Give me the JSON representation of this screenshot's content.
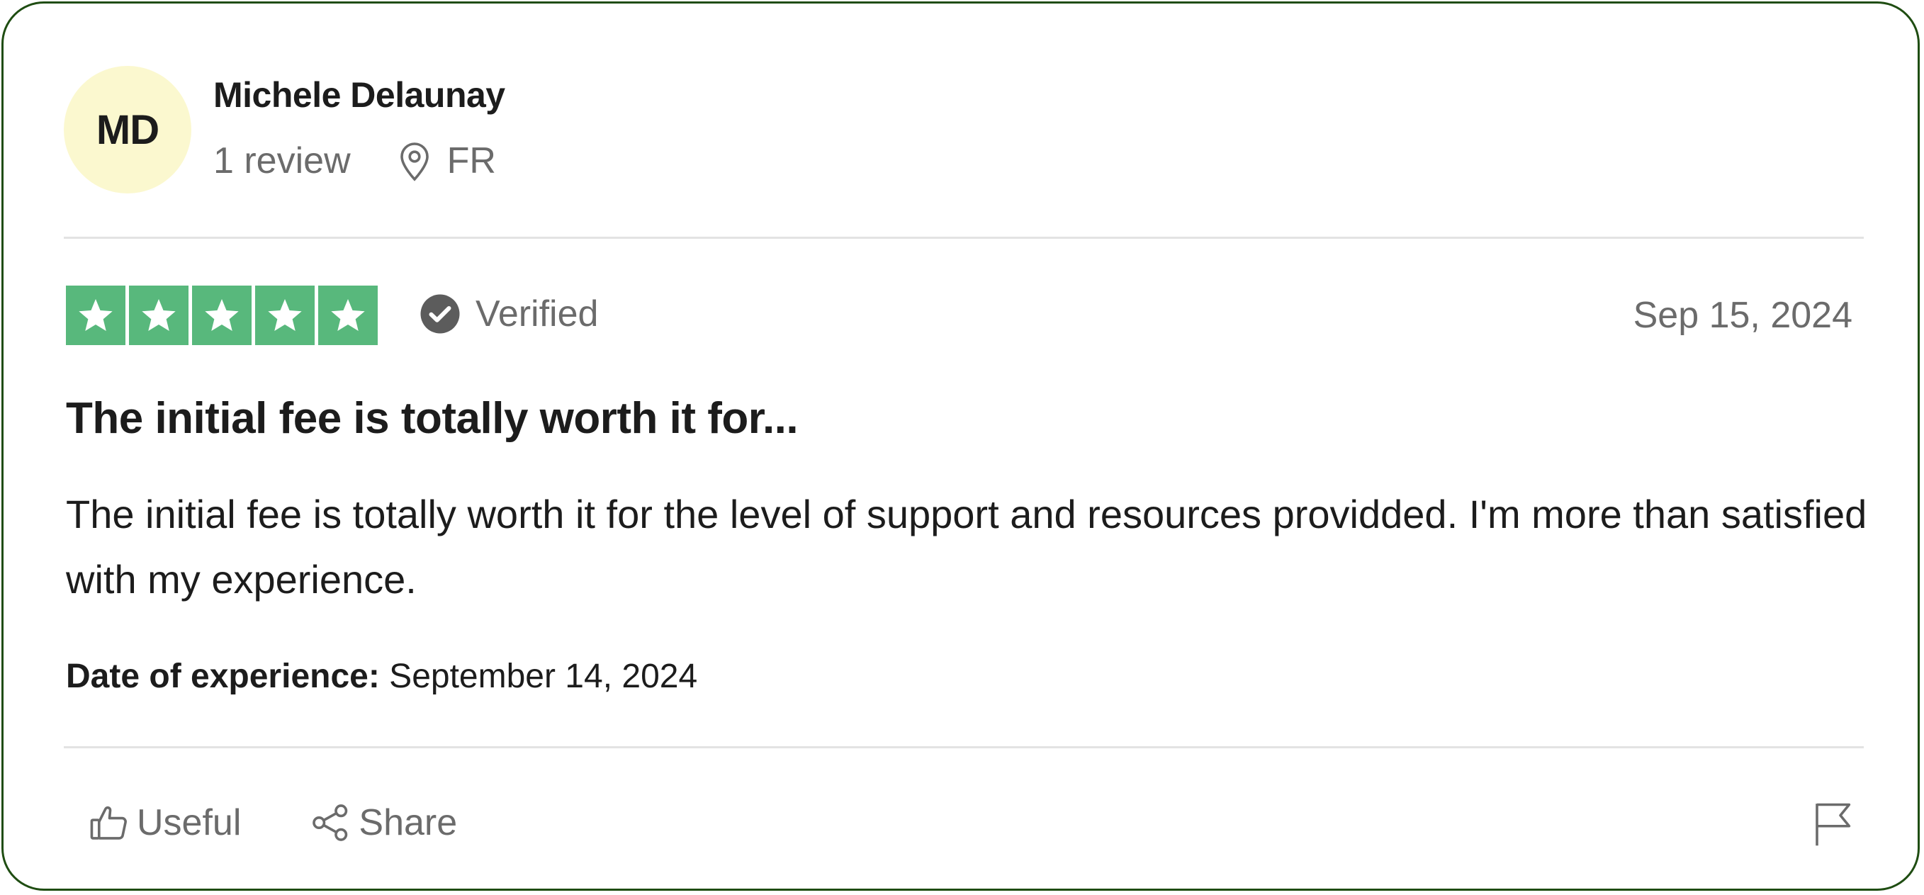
{
  "author": {
    "initials": "MD",
    "name": "Michele Delaunay",
    "review_count": "1 review",
    "country": "FR",
    "avatar_color": "#fbf8cf"
  },
  "rating": {
    "stars": 5,
    "max": 5,
    "star_color": "#58b87c"
  },
  "verified_label": "Verified",
  "review_date": "Sep 15, 2024",
  "review": {
    "title": "The initial fee is totally worth it for...",
    "body": "The initial fee is totally worth it for the level of support and resources providded. I'm more than satisfied with my experience."
  },
  "experience": {
    "label": "Date of experience:",
    "value": "September 14, 2024"
  },
  "actions": {
    "useful_label": "Useful",
    "share_label": "Share"
  },
  "icons": [
    "location-pin-icon",
    "star-icon",
    "verified-check-icon",
    "thumbs-up-icon",
    "share-icon",
    "flag-icon"
  ],
  "colors": {
    "border": "#1f4d12",
    "divider": "#e3e3e3",
    "muted_text": "#6b6b6b"
  }
}
